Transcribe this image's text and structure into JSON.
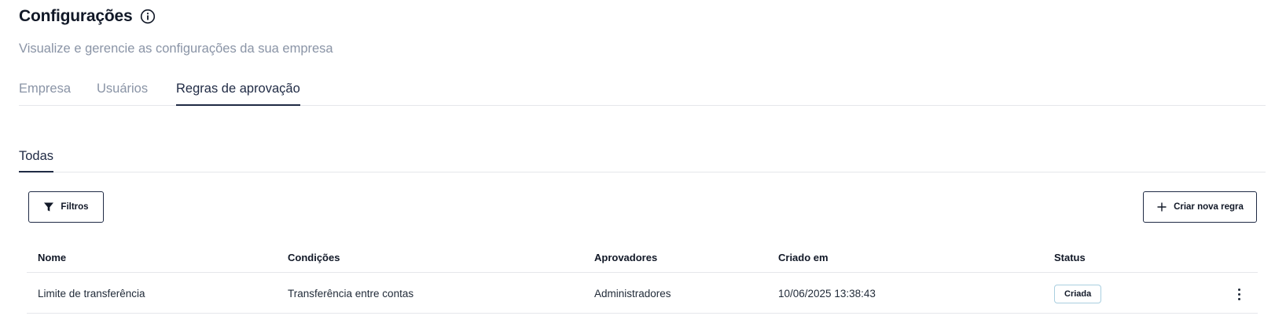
{
  "header": {
    "title": "Configurações",
    "info_icon": "info-icon",
    "subtitle": "Visualize e gerencie as configurações da sua empresa"
  },
  "tabs": [
    {
      "label": "Empresa",
      "active": false
    },
    {
      "label": "Usuários",
      "active": false
    },
    {
      "label": "Regras de aprovação",
      "active": true
    }
  ],
  "subtabs": [
    {
      "label": "Todas",
      "active": true
    }
  ],
  "toolbar": {
    "filter_label": "Filtros",
    "filter_icon": "filter-icon",
    "new_rule_label": "Criar nova regra",
    "new_rule_icon": "plus-icon"
  },
  "table": {
    "columns": [
      "Nome",
      "Condições",
      "Aprovadores",
      "Criado em",
      "Status"
    ],
    "rows": [
      {
        "name": "Limite de transferência",
        "conditions": "Transferência entre contas",
        "approvers": "Administradores",
        "created_at": "10/06/2025 13:38:43",
        "status": "Criada"
      }
    ]
  },
  "colors": {
    "primary": "#1f2a44",
    "muted_text": "#8a94a6",
    "divider": "#e5e7eb",
    "badge_border": "#a9cfe0"
  }
}
